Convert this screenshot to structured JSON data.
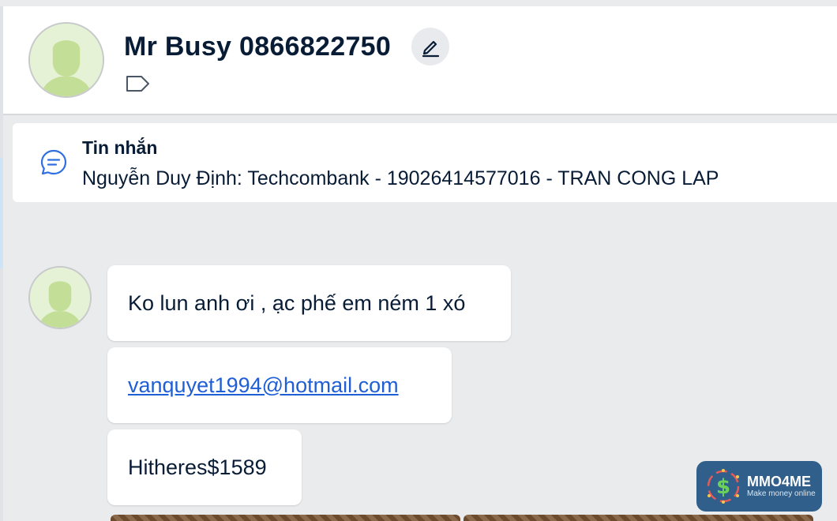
{
  "header": {
    "contact_name": "Mr Busy 0866822750",
    "edit_icon": "pencil-icon",
    "tag_icon": "tag-icon"
  },
  "pinned": {
    "icon": "chat-bubble-icon",
    "title": "Tin nhắn",
    "text": "Nguyễn Duy Định: Techcombank - 19026414577016 - TRAN CONG LAP"
  },
  "messages": [
    {
      "text": "Ko lun anh ơi , ạc phế em ném 1 xó",
      "type": "text"
    },
    {
      "text": "vanquyet1994@hotmail.com",
      "type": "link"
    },
    {
      "text": "Hitheres$1589",
      "type": "text"
    }
  ],
  "watermark": {
    "title": "MMO4ME",
    "subtitle": "Make money online"
  },
  "colors": {
    "background": "#e9ebed",
    "bubble": "#ffffff",
    "link": "#1f5fd6",
    "text": "#081c36",
    "watermark_bg": "#2f5f8a"
  }
}
